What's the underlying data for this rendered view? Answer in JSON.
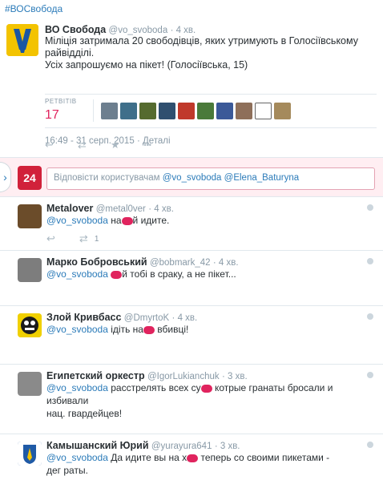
{
  "hashtag": "#ВОСвобода",
  "main_tweet": {
    "name": "ВО Свобода",
    "handle": "@vo_svoboda",
    "time": "· 4 хв.",
    "line1": "Міліція затримала 20 свободівців, яких утримують в Голосіївському",
    "line2": "райвідділі.",
    "line3": "Усіх запрошуємо на пікет!  (Голосіївська, 15)",
    "retweets_label": "РЕТВІТІВ",
    "retweets_count": "17",
    "datetime": "16:49 - 31 серп. 2015",
    "details": "· Деталі"
  },
  "reply_box": {
    "avatar_text": "24",
    "prefix": "Відповісти користувачам ",
    "mention1": "@vo_svoboda",
    "mention2": "@Elena_Baturyna",
    "chevron": "›"
  },
  "icons": {
    "reply": "↩",
    "retweet": "⇄",
    "favorite": "★",
    "more": "•••"
  },
  "replies": [
    {
      "name": "Metalover",
      "handle": "@metal0ver",
      "time": "· 4 хв.",
      "mention": "@vo_svoboda",
      "before": " на",
      "after": "й идите.",
      "line2": "",
      "retweet_count": "1"
    },
    {
      "name": "Марко Бобровський",
      "handle": "@bobmark_42",
      "time": "· 4 хв.",
      "mention": "@vo_svoboda",
      "before": " ",
      "after": "й тобі в сраку, а не пікет...",
      "line2": "",
      "retweet_count": ""
    },
    {
      "name": "Злой Кривбасс",
      "handle": "@DmyrtoK",
      "time": "· 4 хв.",
      "mention": "@vo_svoboda",
      "before": " ідіть на",
      "after": " вбивці!",
      "line2": "",
      "retweet_count": ""
    },
    {
      "name": "Египетский оркестр",
      "handle": "@IgorLukianchuk",
      "time": "· 3 хв.",
      "mention": "@vo_svoboda",
      "before": " расстрелять всех су",
      "after": " котрые гранаты бросали и избивали",
      "line2": "нац. гвардейцев!",
      "retweet_count": ""
    },
    {
      "name": "Камышанский Юрий",
      "handle": "@yurayura641",
      "time": "· 3 хв.",
      "mention": "@vo_svoboda",
      "before": " Да идите вы на х",
      "after": " теперь со своими пикетами -",
      "line2": "дег   раты.",
      "retweet_count": ""
    }
  ]
}
